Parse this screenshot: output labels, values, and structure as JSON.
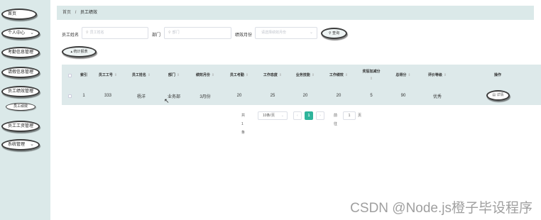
{
  "sidebar": {
    "items": [
      {
        "label": "首页",
        "expandable": false
      },
      {
        "label": "个人中心",
        "expandable": true
      },
      {
        "label": "考勤信息管理",
        "expandable": false
      },
      {
        "label": "请假信息管理",
        "expandable": false
      },
      {
        "label": "员工绩效管理",
        "expandable": true
      },
      {
        "label": "员工工资管理",
        "expandable": false
      },
      {
        "label": "系统管理",
        "expandable": true
      }
    ],
    "subitem": {
      "label": "员工绩效"
    },
    "chevron": "⌄"
  },
  "breadcrumb": {
    "home": "首页",
    "separator": "/",
    "current": "员工绩效"
  },
  "filters": {
    "name": {
      "label": "员工姓名",
      "placeholder": "员工姓名"
    },
    "department": {
      "label": "部门",
      "placeholder": "部门"
    },
    "month": {
      "label": "绩效月份",
      "placeholder": "请选择绩效月份"
    },
    "search_label": "查询",
    "search_icon": "search-icon"
  },
  "stats_button": {
    "label": "统计报表",
    "icon": "chart-icon"
  },
  "table": {
    "headers": [
      "索引",
      "员工工号",
      "员工姓名",
      "部门",
      "绩效月份",
      "员工考勤",
      "工作态度",
      "业务技能",
      "工作绩效",
      "奖惩加减分",
      "总得分",
      "评价等级",
      "操作"
    ],
    "sort_glyph": "⇕",
    "rows": [
      {
        "index": "1",
        "employee_id": "333",
        "employee_name": "杨洋",
        "department": "业务部",
        "month": "3月份",
        "attendance": "20",
        "attitude": "25",
        "skills": "20",
        "performance": "20",
        "bonus": "5",
        "total": "90",
        "grade": "优秀",
        "action": "详情"
      }
    ]
  },
  "pagination": {
    "total": "共 1 条",
    "page_size": "10条/页",
    "prev": "‹",
    "current_page": "1",
    "next": "›",
    "goto_prefix": "前往",
    "goto_value": "1",
    "goto_suffix": "页"
  },
  "watermark": "CSDN @Node.js橙子毕设程序",
  "colors": {
    "sidebar_bg": "#dbe9e9",
    "table_bg": "#dde9ea",
    "accent": "#2eb49b"
  }
}
